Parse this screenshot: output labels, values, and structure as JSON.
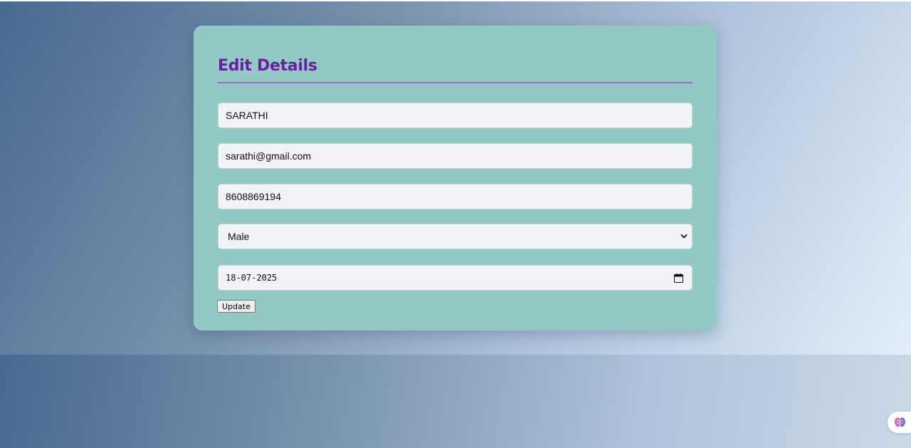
{
  "form": {
    "title": "Edit Details",
    "name_value": "SARATHI",
    "email_value": "sarathi@gmail.com",
    "phone_value": "8608869194",
    "gender_selected": "Male",
    "date_value": "18-07-2025",
    "update_label": "Update"
  },
  "colors": {
    "card_background": "#93c9c4",
    "title_color": "#6a1fa0",
    "divider_color": "#a366c9",
    "field_background": "#f2f3f6"
  },
  "icons": {
    "select_icon": "chevron-down-icon",
    "date_icon": "calendar-icon",
    "extension_icon": "brain-icon"
  }
}
